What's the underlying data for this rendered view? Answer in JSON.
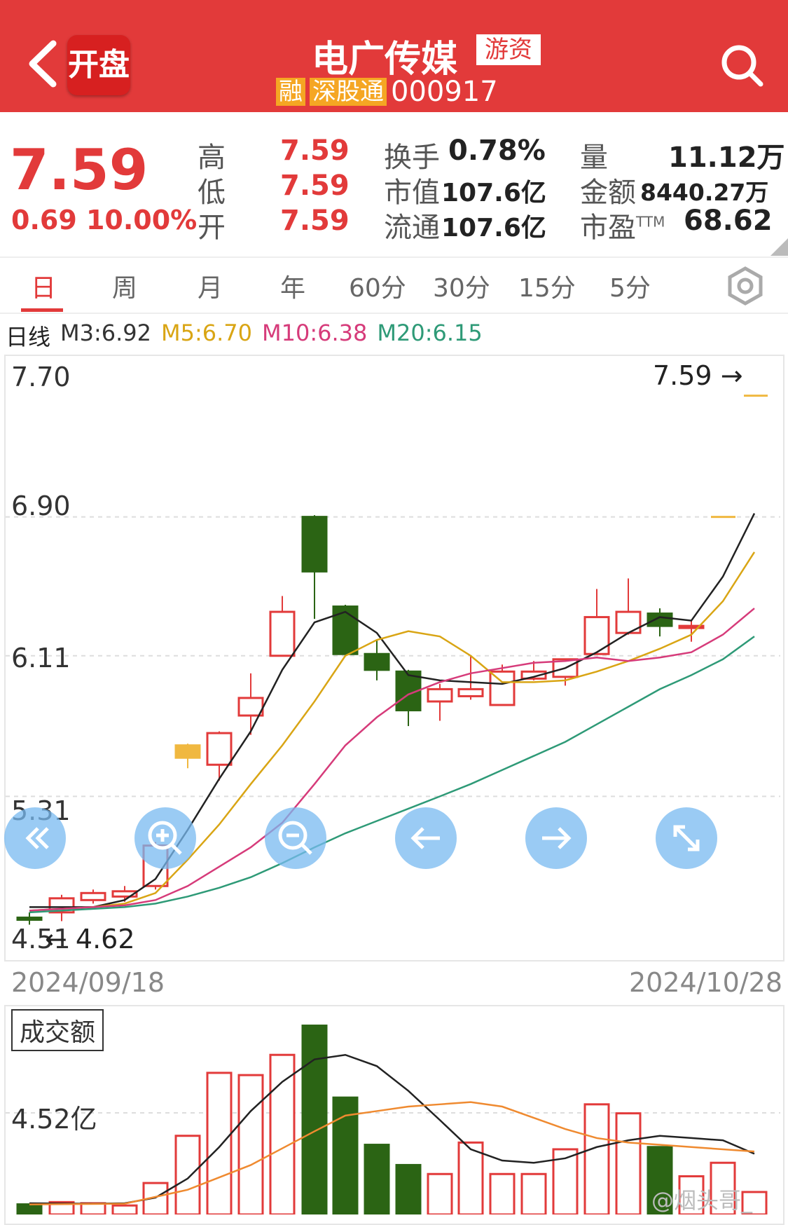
{
  "header": {
    "logo_label": "开盘",
    "title": "电广传媒",
    "tag": "游资",
    "sub_tags": [
      "融",
      "深股通"
    ],
    "code": "000917",
    "colors": {
      "bar": "#e23a3a",
      "tag_orange": "#f5a623"
    }
  },
  "quote": {
    "price": "7.59",
    "change": "0.69 10.00%",
    "high_label": "高",
    "high": "7.59",
    "low_label": "低",
    "low": "7.59",
    "open_label": "开",
    "open": "7.59",
    "turnover_label": "换手",
    "turnover": "0.78%",
    "mktcap_label": "市值",
    "mktcap": "107.6亿",
    "float_label": "流通",
    "float": "107.6亿",
    "vol_label": "量",
    "vol": "11.12万",
    "amount_label": "金额",
    "amount": "8440.27万",
    "pe_label": "市盈",
    "pe_sup": "TTM",
    "pe": "68.62"
  },
  "tabs": [
    "日",
    "周",
    "月",
    "年",
    "60分",
    "30分",
    "15分",
    "5分"
  ],
  "ma": {
    "kline_label": "日线",
    "m3": "M3:6.92",
    "m5": "M5:6.70",
    "m10": "M10:6.38",
    "m20": "M20:6.15",
    "colors": {
      "m3": "#222222",
      "m5": "#d9a514",
      "m10": "#d63b7a",
      "m20": "#2e9a77"
    }
  },
  "kline": {
    "y_ticks": [
      "7.70",
      "6.90",
      "6.11",
      "5.31",
      "4.51"
    ],
    "last_label": "7.59",
    "low_label": "4.62",
    "date_start": "2024/09/18",
    "date_end": "2024/10/28"
  },
  "volume": {
    "tag": "成交额",
    "tick": "4.52亿"
  },
  "nav_buttons": [
    "rewind-icon",
    "zoom-in-icon",
    "zoom-out-icon",
    "arrow-left-icon",
    "arrow-right-icon",
    "expand-icon"
  ],
  "watermark": "@烟头哥_"
}
